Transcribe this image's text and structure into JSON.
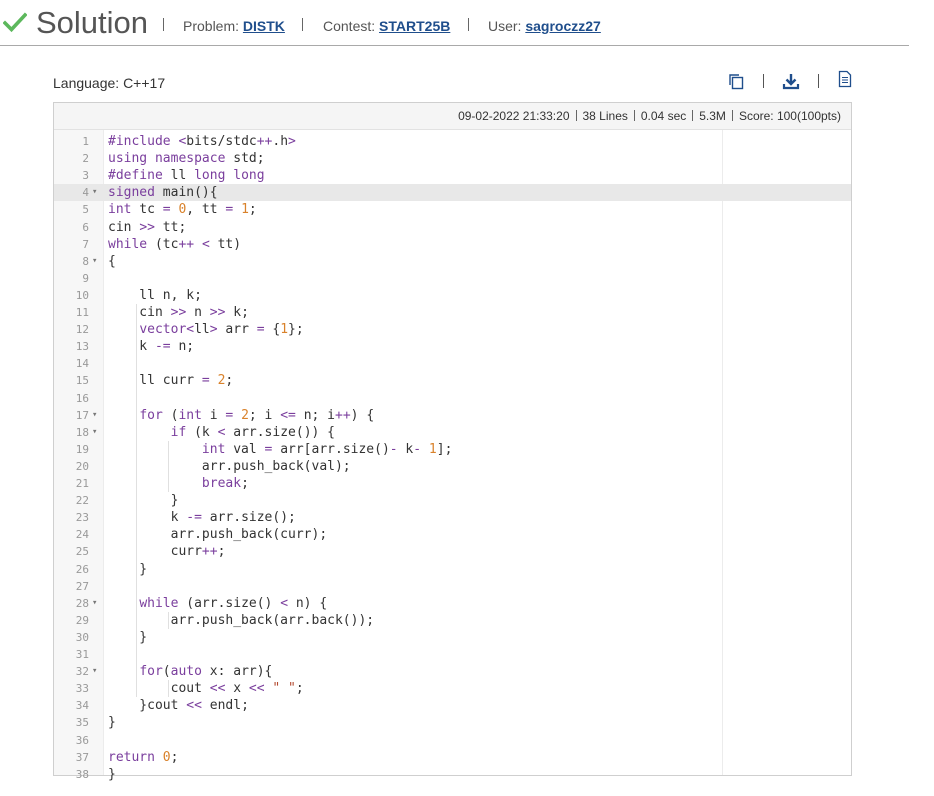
{
  "header": {
    "title": "Solution",
    "problem_label": "Problem:",
    "problem": "DISTK",
    "contest_label": "Contest:",
    "contest": "START25B",
    "user_label": "User:",
    "user": "sagroczz27"
  },
  "language": "Language: C++17",
  "toolbar": {
    "copy_icon": "copy-icon",
    "download_icon": "download-icon",
    "file_icon": "file-text-icon"
  },
  "stats": {
    "date": "09-02-2022 21:33:20",
    "lines": "38 Lines",
    "time": "0.04 sec",
    "memory": "5.3M",
    "score": "Score: 100(100pts)"
  },
  "colors": {
    "check": "#5cb85c",
    "link": "#1f4e8c",
    "keyword": "#7a3e9d",
    "number": "#d9822b"
  },
  "code": [
    "#include <bits/stdc++.h>",
    "using namespace std;",
    "#define ll long long",
    "signed main(){",
    "int tc = 0, tt = 1;",
    "cin >> tt;",
    "while (tc++ < tt)",
    "{",
    "",
    "    ll n, k;",
    "    cin >> n >> k;",
    "    vector<ll> arr = {1};",
    "    k -= n;",
    "",
    "    ll curr = 2;",
    "",
    "    for (int i = 2; i <= n; i++) {",
    "        if (k < arr.size()) {",
    "            int val = arr[arr.size()- k- 1];",
    "            arr.push_back(val);",
    "            break;",
    "        }",
    "        k -= arr.size();",
    "        arr.push_back(curr);",
    "        curr++;",
    "    }",
    "",
    "    while (arr.size() < n) {",
    "        arr.push_back(arr.back());",
    "    }",
    "",
    "    for(auto x: arr){",
    "        cout << x << \" \";",
    "    }cout << endl;",
    "}",
    "",
    "return 0;",
    "}"
  ],
  "fold_lines": [
    4,
    8,
    17,
    18,
    28,
    32
  ],
  "active_line": 4
}
